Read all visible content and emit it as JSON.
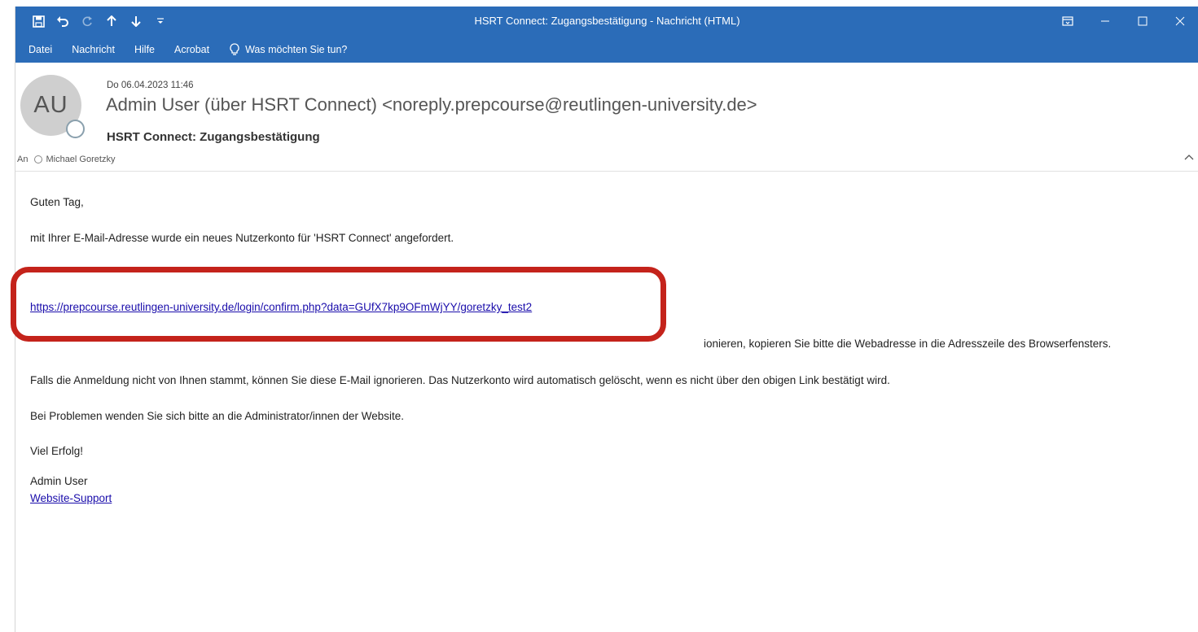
{
  "window": {
    "title": "HSRT Connect: Zugangsbestätigung  -  Nachricht (HTML)",
    "quick_access": [
      "save-icon",
      "undo-icon",
      "redo-icon",
      "up-arrow-icon",
      "down-arrow-icon",
      "customize-icon"
    ],
    "controls": [
      "ribbon-display-icon",
      "minimize-icon",
      "maximize-icon",
      "close-icon"
    ]
  },
  "menu": {
    "items": [
      "Datei",
      "Nachricht",
      "Hilfe",
      "Acrobat"
    ],
    "tell_me": "Was möchten Sie tun?"
  },
  "message": {
    "avatar_initials": "AU",
    "date": "Do 06.04.2023 11:46",
    "sender": "Admin User  (über HSRT Connect) <noreply.prepcourse@reutlingen-university.de>",
    "subject": "HSRT Connect: Zugangsbestätigung",
    "to_label": "An",
    "to_name": "Michael Goretzky"
  },
  "body": {
    "greeting": "Guten Tag,",
    "line1": "mit Ihrer E-Mail-Adresse wurde ein neues Nutzerkonto für 'HSRT Connect' angefordert.",
    "link": "https://prepcourse.reutlingen-university.de/login/confirm.php?data=GUfX7kp9OFmWjYY/goretzky_test2",
    "line3_visible": "ionieren, kopieren Sie bitte die Webadresse in die Adresszeile des Browserfensters.",
    "line4": "Falls die Anmeldung nicht von Ihnen stammt, können Sie diese E-Mail ignorieren. Das Nutzerkonto wird automatisch gelöscht, wenn es nicht über den obigen Link bestätigt wird.",
    "line5": "Bei Problemen wenden Sie sich bitte an die Administrator/innen der Website.",
    "line6": "Viel Erfolg!",
    "signature_name": "Admin User",
    "signature_link": "Website-Support"
  },
  "colors": {
    "titlebar": "#2b6cb8",
    "callout": "#c4231b",
    "link": "#1a0dab"
  }
}
